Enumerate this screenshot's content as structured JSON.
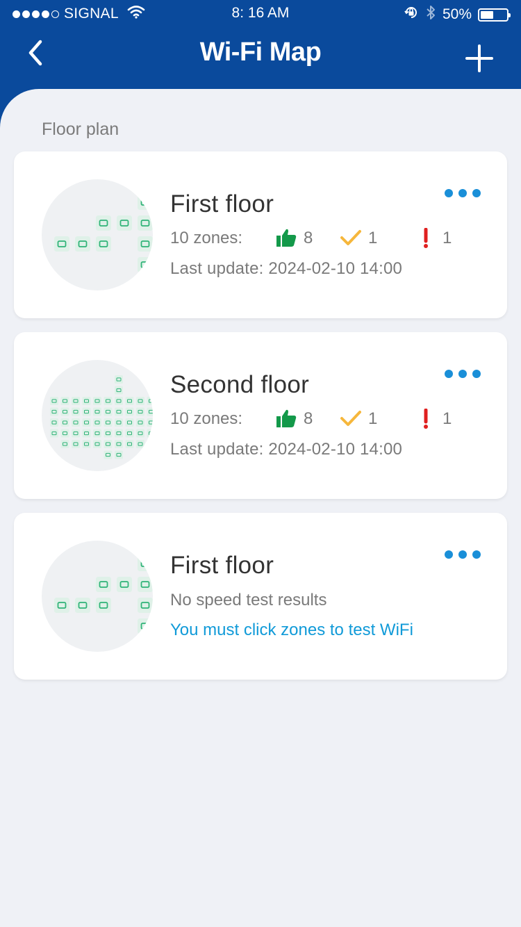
{
  "status_bar": {
    "carrier": "SIGNAL",
    "time": "8: 16 AM",
    "battery": "50%",
    "battery_level": 0.5,
    "signal_bars": 4
  },
  "header": {
    "title": "Wi-Fi Map",
    "back_icon": "chevron-left-icon",
    "add_icon": "plus-icon"
  },
  "section_label": "Floor plan",
  "cards": [
    {
      "title": "First floor",
      "zones_label": "10 zones:",
      "good_count": "8",
      "ok_count": "1",
      "bad_count": "1",
      "last_update": "Last update: 2024-02-10 14:00"
    },
    {
      "title": "Second floor",
      "zones_label": "10 zones:",
      "good_count": "8",
      "ok_count": "1",
      "bad_count": "1",
      "last_update": "Last update: 2024-02-10 14:00"
    },
    {
      "title": "First floor",
      "no_results": "No speed test results",
      "link": "You must click zones to test WiFi"
    }
  ],
  "colors": {
    "header_bg": "#0a4a9c",
    "good": "#13994a",
    "ok": "#f6b73c",
    "bad": "#e02020",
    "link": "#109ad8",
    "more_dots": "#1a8fd8",
    "zone_icon": "#2fb377"
  }
}
